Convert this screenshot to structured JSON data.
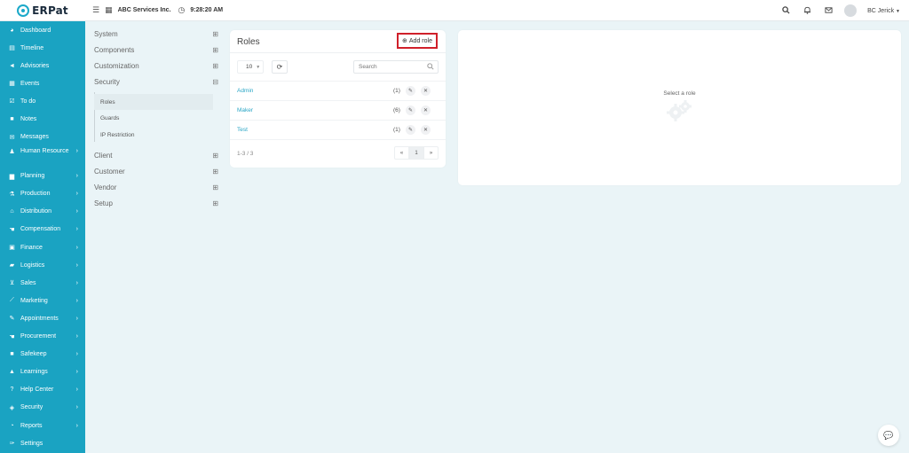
{
  "app": {
    "logo_text": "ERPat"
  },
  "topbar": {
    "menu_icon": "list-icon",
    "company": "ABC Services Inc.",
    "time": "9:28:20 AM",
    "user_name": "BC Jerick"
  },
  "sidebar": {
    "items": [
      {
        "label": "Dashboard",
        "icon": "dashboard-icon",
        "caret": false
      },
      {
        "label": "Timeline",
        "icon": "timeline-icon",
        "caret": false
      },
      {
        "label": "Advisories",
        "icon": "megaphone-icon",
        "caret": false
      },
      {
        "label": "Events",
        "icon": "calendar-icon",
        "caret": false
      },
      {
        "label": "To do",
        "icon": "checkbox-icon",
        "caret": false
      },
      {
        "label": "Notes",
        "icon": "notes-icon",
        "caret": false
      },
      {
        "label": "Messages",
        "icon": "envelope-icon",
        "caret": false
      },
      {
        "label": "Human Resource",
        "icon": "users-icon",
        "caret": true
      },
      {
        "label": "Planning",
        "icon": "briefcase-icon",
        "caret": true
      },
      {
        "label": "Production",
        "icon": "flask-icon",
        "caret": true
      },
      {
        "label": "Distribution",
        "icon": "bank-icon",
        "caret": true
      },
      {
        "label": "Compensation",
        "icon": "handshake-icon",
        "caret": true
      },
      {
        "label": "Finance",
        "icon": "money-icon",
        "caret": true
      },
      {
        "label": "Logistics",
        "icon": "truck-icon",
        "caret": true
      },
      {
        "label": "Sales",
        "icon": "cart-icon",
        "caret": true
      },
      {
        "label": "Marketing",
        "icon": "chart-line-icon",
        "caret": true
      },
      {
        "label": "Appointments",
        "icon": "edit-icon",
        "caret": true
      },
      {
        "label": "Procurement",
        "icon": "handshake-icon",
        "caret": true
      },
      {
        "label": "Safekeep",
        "icon": "box-icon",
        "caret": true
      },
      {
        "label": "Learnings",
        "icon": "graduation-cap-icon",
        "caret": true
      },
      {
        "label": "Help Center",
        "icon": "help-circle-icon",
        "caret": true
      },
      {
        "label": "Security",
        "icon": "shield-icon",
        "caret": true
      },
      {
        "label": "Reports",
        "icon": "pie-chart-icon",
        "caret": true
      },
      {
        "label": "Settings",
        "icon": "wrench-icon",
        "caret": false
      }
    ]
  },
  "submenu": {
    "groups": [
      {
        "label": "System",
        "toggle": "⊞"
      },
      {
        "label": "Components",
        "toggle": "⊞"
      },
      {
        "label": "Customization",
        "toggle": "⊞"
      },
      {
        "label": "Security",
        "toggle": "⊟"
      }
    ],
    "security_children": [
      "Roles",
      "Guards",
      "IP Restriction"
    ],
    "more_groups": [
      {
        "label": "Client",
        "toggle": "⊞"
      },
      {
        "label": "Customer",
        "toggle": "⊞"
      },
      {
        "label": "Vendor",
        "toggle": "⊞"
      },
      {
        "label": "Setup",
        "toggle": "⊞"
      }
    ]
  },
  "roles_panel": {
    "title": "Roles",
    "add_label": "Add role",
    "page_size": "10",
    "search_placeholder": "Search",
    "rows": [
      {
        "name": "Admin",
        "count": "(1)"
      },
      {
        "name": "Maker",
        "count": "(6)"
      },
      {
        "name": "Test",
        "count": "(1)"
      }
    ],
    "range_text": "1-3 / 3",
    "prev_label": "«",
    "current_page": "1",
    "next_label": "»"
  },
  "detail_panel": {
    "empty_text": "Select a role",
    "empty_icon": "gears-icon"
  },
  "colors": {
    "sidebar_bg": "#1aa3c2",
    "accent": "#2aa6c6",
    "highlight_border": "#d0202a",
    "page_bg": "#eaf4f7"
  }
}
